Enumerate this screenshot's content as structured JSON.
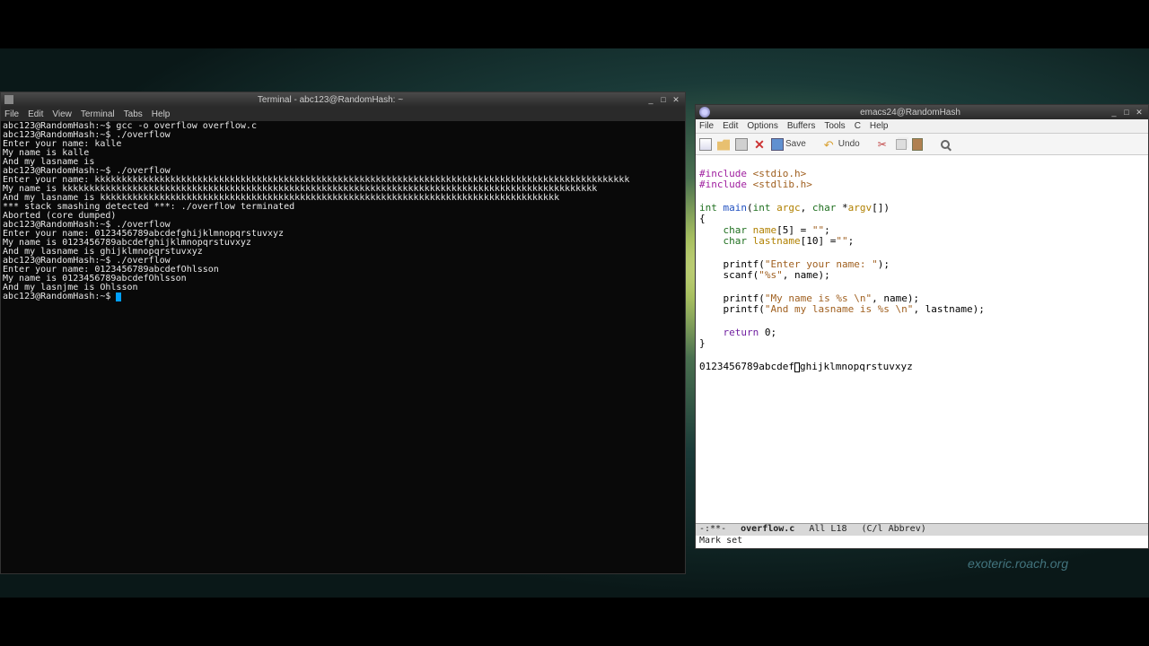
{
  "terminal": {
    "title": "Terminal - abc123@RandomHash: ~",
    "menu": [
      "File",
      "Edit",
      "View",
      "Terminal",
      "Tabs",
      "Help"
    ],
    "lines": [
      "abc123@RandomHash:~$ gcc -o overflow overflow.c",
      "abc123@RandomHash:~$ ./overflow",
      "Enter your name: kalle",
      "My name is kalle",
      "And my lasname is",
      "abc123@RandomHash:~$ ./overflow",
      "Enter your name: kkkkkkkkkkkkkkkkkkkkkkkkkkkkkkkkkkkkkkkkkkkkkkkkkkkkkkkkkkkkkkkkkkkkkkkkkkkkkkkkkkkkkkkkkkkkkkkkkkk",
      "My name is kkkkkkkkkkkkkkkkkkkkkkkkkkkkkkkkkkkkkkkkkkkkkkkkkkkkkkkkkkkkkkkkkkkkkkkkkkkkkkkkkkkkkkkkkkkkkkkkkkk",
      "And my lasname is kkkkkkkkkkkkkkkkkkkkkkkkkkkkkkkkkkkkkkkkkkkkkkkkkkkkkkkkkkkkkkkkkkkkkkkkkkkkkkkkkkkkk",
      "*** stack smashing detected ***: ./overflow terminated",
      "Aborted (core dumped)",
      "abc123@RandomHash:~$ ./overflow",
      "Enter your name: 0123456789abcdefghijklmnopqrstuvxyz",
      "My name is 0123456789abcdefghijklmnopqrstuvxyz",
      "And my lasname is ghijklmnopqrstuvxyz",
      "abc123@RandomHash:~$ ./overflow",
      "Enter your name: 0123456789abcdefOhlsson",
      "My name is 0123456789abcdefOhlsson",
      "And my lasnjme is Ohlsson",
      "abc123@RandomHash:~$ "
    ]
  },
  "emacs": {
    "title": "emacs24@RandomHash",
    "menu": [
      "File",
      "Edit",
      "Options",
      "Buffers",
      "Tools",
      "C",
      "Help"
    ],
    "toolbar": {
      "save": "Save",
      "undo": "Undo"
    },
    "code": {
      "l1a": "#include",
      "l1b": " <stdio.h>",
      "l2a": "#include",
      "l2b": " <stdlib.h>",
      "l3": "",
      "l4a": "int",
      "l4b": " ",
      "l4c": "main",
      "l4d": "(",
      "l4e": "int",
      "l4f": " ",
      "l4g": "argc",
      "l4h": ", ",
      "l4i": "char",
      "l4j": " *",
      "l4k": "argv",
      "l4l": "[])",
      "l5": "{",
      "l6a": "    ",
      "l6b": "char",
      "l6c": " ",
      "l6d": "name",
      "l6e": "[5] = ",
      "l6f": "\"\"",
      "l6g": ";",
      "l7a": "    ",
      "l7b": "char",
      "l7c": " ",
      "l7d": "lastname",
      "l7e": "[10] =",
      "l7f": "\"\"",
      "l7g": ";",
      "l8": "",
      "l9a": "    printf(",
      "l9b": "\"Enter your name: \"",
      "l9c": ");",
      "l10a": "    scanf(",
      "l10b": "\"%s\"",
      "l10c": ", name);",
      "l11": "",
      "l12a": "    printf(",
      "l12b": "\"My name is %s \\n\"",
      "l12c": ", name);",
      "l13a": "    printf(",
      "l13b": "\"And my lasname is %s \\n\"",
      "l13c": ", lastname);",
      "l14": "",
      "l15a": "    ",
      "l15b": "return",
      "l15c": " 0;",
      "l16": "}",
      "l17": "",
      "l18a": "0123456789abcdef",
      "l18b": "ghijklmnopqrstuvxyz"
    },
    "modeline": {
      "status": "-:**-",
      "file": "overflow.c",
      "pos": "All L18",
      "mode": "(C/l Abbrev)"
    },
    "minibuf": "Mark set"
  },
  "watermark": "exoteric.roach.org"
}
